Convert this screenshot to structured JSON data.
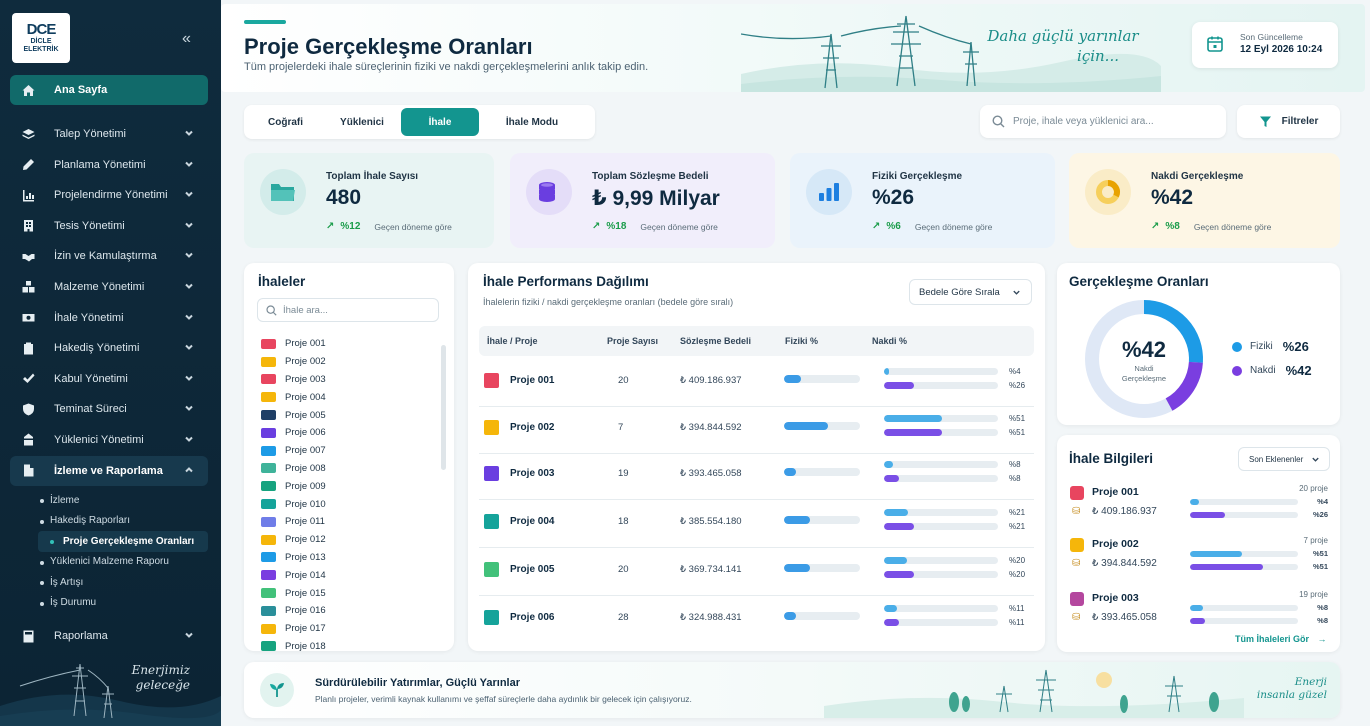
{
  "brand": {
    "logo_mark": "DCE",
    "logo_text_1": "DİCLE",
    "logo_text_2": "ELEKTRİK",
    "sidebar_slogan_1": "Enerjimiz",
    "sidebar_slogan_2": "geleceğe"
  },
  "sidebar": {
    "items": [
      {
        "label": "Ana Sayfa",
        "icon": "home-icon",
        "state": "active"
      },
      {
        "label": "Talep Yönetimi",
        "icon": "layers-icon"
      },
      {
        "label": "Planlama Yönetimi",
        "icon": "pencil-icon"
      },
      {
        "label": "Projelendirme Yönetimi",
        "icon": "chart-icon"
      },
      {
        "label": "Tesis Yönetimi",
        "icon": "building-icon"
      },
      {
        "label": "İzin ve Kamulaştırma",
        "icon": "handshake-icon"
      },
      {
        "label": "Malzeme Yönetimi",
        "icon": "boxes-icon"
      },
      {
        "label": "İhale Yönetimi",
        "icon": "money-icon"
      },
      {
        "label": "Hakediş Yönetimi",
        "icon": "clipboard-icon"
      },
      {
        "label": "Kabul Yönetimi",
        "icon": "check-icon"
      },
      {
        "label": "Teminat Süreci",
        "icon": "shield-icon"
      },
      {
        "label": "Yüklenici Yönetimi",
        "icon": "worker-icon"
      },
      {
        "label": "İzleme ve Raporlama",
        "icon": "document-icon",
        "state": "open"
      }
    ],
    "sub_items": [
      {
        "label": "İzleme"
      },
      {
        "label": "Hakediş Raporları"
      },
      {
        "label": "Proje Gerçekleşme Oranları",
        "state": "active"
      },
      {
        "label": "Yüklenici Malzeme Raporu"
      },
      {
        "label": "İş Artışı"
      },
      {
        "label": "İş Durumu"
      }
    ],
    "last_item": {
      "label": "Raporlama",
      "icon": "calculator-icon"
    }
  },
  "header": {
    "title": "Proje Gerçekleşme Oranları",
    "subtitle": "Tüm projelerdeki ihale süreçlerinin fiziki ve nakdi gerçekleşmelerini anlık takip edin.",
    "slogan_1": "Daha güçlü yarınlar",
    "slogan_2": "için...",
    "update_label": "Son Güncelleme",
    "update_value": "12 Eyl 2026 10:24"
  },
  "tabs": [
    {
      "label": "Coğrafi"
    },
    {
      "label": "Yüklenici"
    },
    {
      "label": "İhale",
      "active": true
    },
    {
      "label": "İhale Modu"
    }
  ],
  "search": {
    "placeholder": "Proje, ihale veya yüklenici ara..."
  },
  "filter_label": "Filtreler",
  "kpis": [
    {
      "label": "Toplam İhale Sayısı",
      "value": "480",
      "trend": "%12",
      "note": "Geçen döneme göre",
      "bg": "#e8f4f3",
      "icon_bg": "#d3ecea",
      "icon": "folder-icon"
    },
    {
      "label": "Toplam Sözleşme Bedeli",
      "value": "₺ 9,99 Milyar",
      "trend": "%18",
      "note": "Geçen döneme göre",
      "bg": "#f1eefb",
      "icon_bg": "#e4ddf8",
      "icon": "coins-icon"
    },
    {
      "label": "Fiziki Gerçekleşme",
      "value": "%26",
      "trend": "%6",
      "note": "Geçen döneme göre",
      "bg": "#eaf3fb",
      "icon_bg": "#d6e8f7",
      "icon": "bars-icon"
    },
    {
      "label": "Nakdi Gerçekleşme",
      "value": "%42",
      "trend": "%8",
      "note": "Geçen döneme göre",
      "bg": "#fdf6e5",
      "icon_bg": "#faecc7",
      "icon": "donut-icon"
    }
  ],
  "ihaleler": {
    "title": "İhaleler",
    "search_placeholder": "İhale ara...",
    "items": [
      {
        "label": "Proje 001",
        "color": "#e8455f"
      },
      {
        "label": "Proje 002",
        "color": "#f5b60a"
      },
      {
        "label": "Proje 003",
        "color": "#e8455f"
      },
      {
        "label": "Proje 004",
        "color": "#f5b60a"
      },
      {
        "label": "Proje 005",
        "color": "#1f3f66"
      },
      {
        "label": "Proje 006",
        "color": "#6a3ee0"
      },
      {
        "label": "Proje 007",
        "color": "#1d9be6"
      },
      {
        "label": "Proje 008",
        "color": "#3fb39a"
      },
      {
        "label": "Proje 009",
        "color": "#16a37f"
      },
      {
        "label": "Proje 010",
        "color": "#15a39a"
      },
      {
        "label": "Proje 011",
        "color": "#6f7de8"
      },
      {
        "label": "Proje 012",
        "color": "#f5b60a"
      },
      {
        "label": "Proje 013",
        "color": "#1d9be6"
      },
      {
        "label": "Proje 014",
        "color": "#7a3ee0"
      },
      {
        "label": "Proje 015",
        "color": "#42c17a"
      },
      {
        "label": "Proje 016",
        "color": "#2a8f9a"
      },
      {
        "label": "Proje 017",
        "color": "#f5b60a"
      },
      {
        "label": "Proje 018",
        "color": "#16a37f"
      }
    ]
  },
  "performance": {
    "title": "İhale Performans Dağılımı",
    "subtitle": "İhalelerin fiziki / nakdi gerçekleşme oranları (bedele göre sıralı)",
    "sort_label": "Bedele Göre Sırala",
    "columns": [
      "İhale / Proje",
      "Proje Sayısı",
      "Sözleşme Bedeli",
      "Fiziki %",
      "Nakdi %"
    ],
    "rows": [
      {
        "name": "Proje 001",
        "color": "#e8455f",
        "count": "20",
        "cost": "₺ 409.186.937",
        "fiziki": 0.22,
        "nakdi_f": 0.04,
        "nakdi_n": 0.26,
        "pct_f": "%4",
        "pct_n": "%26"
      },
      {
        "name": "Proje 002",
        "color": "#f5b60a",
        "count": "7",
        "cost": "₺ 394.844.592",
        "fiziki": 0.58,
        "nakdi_f": 0.51,
        "nakdi_n": 0.51,
        "pct_f": "%51",
        "pct_n": "%51"
      },
      {
        "name": "Proje 003",
        "color": "#6a3ee0",
        "count": "19",
        "cost": "₺ 393.465.058",
        "fiziki": 0.16,
        "nakdi_f": 0.08,
        "nakdi_n": 0.13,
        "pct_f": "%8",
        "pct_n": "%8"
      },
      {
        "name": "Proje 004",
        "color": "#15a39a",
        "count": "18",
        "cost": "₺ 385.554.180",
        "fiziki": 0.34,
        "nakdi_f": 0.21,
        "nakdi_n": 0.26,
        "pct_f": "%21",
        "pct_n": "%21"
      },
      {
        "name": "Proje 005",
        "color": "#42c17a",
        "count": "20",
        "cost": "₺ 369.734.141",
        "fiziki": 0.34,
        "nakdi_f": 0.2,
        "nakdi_n": 0.26,
        "pct_f": "%20",
        "pct_n": "%20"
      },
      {
        "name": "Proje 006",
        "color": "#15a39a",
        "count": "28",
        "cost": "₺ 324.988.431",
        "fiziki": 0.16,
        "nakdi_f": 0.11,
        "nakdi_n": 0.13,
        "pct_f": "%11",
        "pct_n": "%11"
      }
    ]
  },
  "realization": {
    "title": "Gerçekleşme Oranları",
    "center_value": "%42",
    "center_label_1": "Nakdi",
    "center_label_2": "Gerçekleşme",
    "fiziki_label": "Fiziki",
    "fiziki_value": "%26",
    "nakdi_label": "Nakdi",
    "nakdi_value": "%42",
    "fiziki": 0.26,
    "nakdi": 0.42,
    "fiziki_color": "#1d9be6",
    "nakdi_color": "#7a3ee0"
  },
  "info": {
    "title": "İhale Bilgileri",
    "select_label": "Son Eklenenler",
    "see_all": "Tüm İhaleleri Gör",
    "items": [
      {
        "name": "Proje 001",
        "color": "#e8455f",
        "cost": "₺ 409.186.937",
        "count": "20 proje",
        "f": 0.08,
        "n": 0.32,
        "pct_f": "%4",
        "pct_n": "%26"
      },
      {
        "name": "Proje 002",
        "color": "#f5b60a",
        "cost": "₺ 394.844.592",
        "count": "7 proje",
        "f": 0.48,
        "n": 0.68,
        "pct_f": "%51",
        "pct_n": "%51"
      },
      {
        "name": "Proje 003",
        "color": "#b4479e",
        "cost": "₺ 393.465.058",
        "count": "19 proje",
        "f": 0.12,
        "n": 0.14,
        "pct_f": "%8",
        "pct_n": "%8"
      }
    ]
  },
  "banner": {
    "title": "Sürdürülebilir Yatırımlar, Güçlü Yarınlar",
    "subtitle": "Planlı projeler, verimli kaynak kullanımı ve şeffaf süreçlerle daha aydınlık bir gelecek için çalışıyoruz.",
    "slogan_1": "Enerji",
    "slogan_2": "insanla güzel"
  }
}
